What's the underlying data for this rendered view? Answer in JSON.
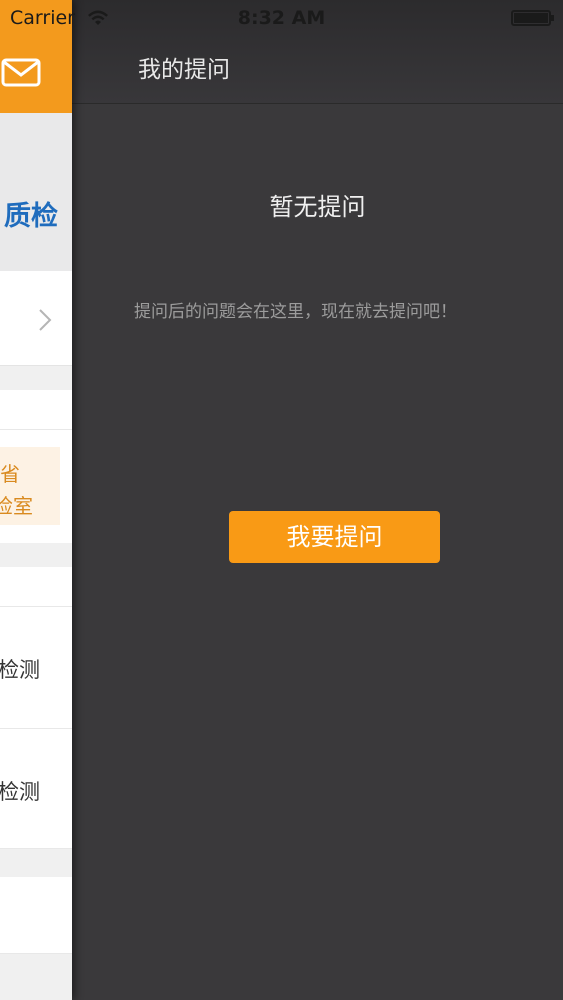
{
  "status_bar": {
    "carrier": "Carrier",
    "time": "8:32 AM"
  },
  "left_panel": {
    "banner_text": "质检",
    "card_lines": [
      "省",
      "检室"
    ],
    "list_items": [
      "检测",
      "检测"
    ],
    "icons": [
      "mail-icon",
      "chevron-right-icon"
    ]
  },
  "nav": {
    "title": "我的提问"
  },
  "empty_state": {
    "title": "暂无提问",
    "description": "提问后的问题会在这里，现在就去提问吧！",
    "button_label": "我要提问"
  },
  "colors": {
    "accent": "#f99a15",
    "background": "#3a393b",
    "link_blue": "#1f6cbd"
  }
}
